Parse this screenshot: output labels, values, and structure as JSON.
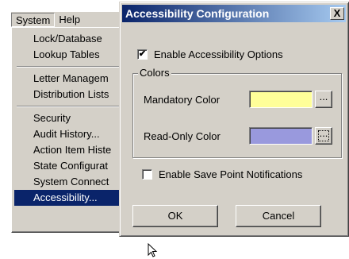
{
  "menubar": {
    "items": [
      "System",
      "Help"
    ]
  },
  "menu": {
    "items": [
      "Lock/Database",
      "Lookup Tables",
      "Letter Managem",
      "Distribution Lists",
      "Security",
      "Audit History...",
      "Action Item Histe",
      "State Configurat",
      "System Connect",
      "Accessibility..."
    ],
    "selected": "Accessibility..."
  },
  "dialog": {
    "title": "Accessibility Configuration",
    "close_label": "X",
    "enable_accessibility": {
      "label": "Enable Accessibility Options",
      "checked": true,
      "mark": "✔"
    },
    "colors_group": "Colors",
    "mandatory": {
      "label": "Mandatory Color",
      "color": "#ffff99",
      "button": "..."
    },
    "readonly": {
      "label": "Read-Only Color",
      "color": "#9999dd",
      "button": "..."
    },
    "enable_save_point": {
      "label": "Enable Save Point Notifications",
      "checked": false
    },
    "ok_label": "OK",
    "cancel_label": "Cancel"
  }
}
